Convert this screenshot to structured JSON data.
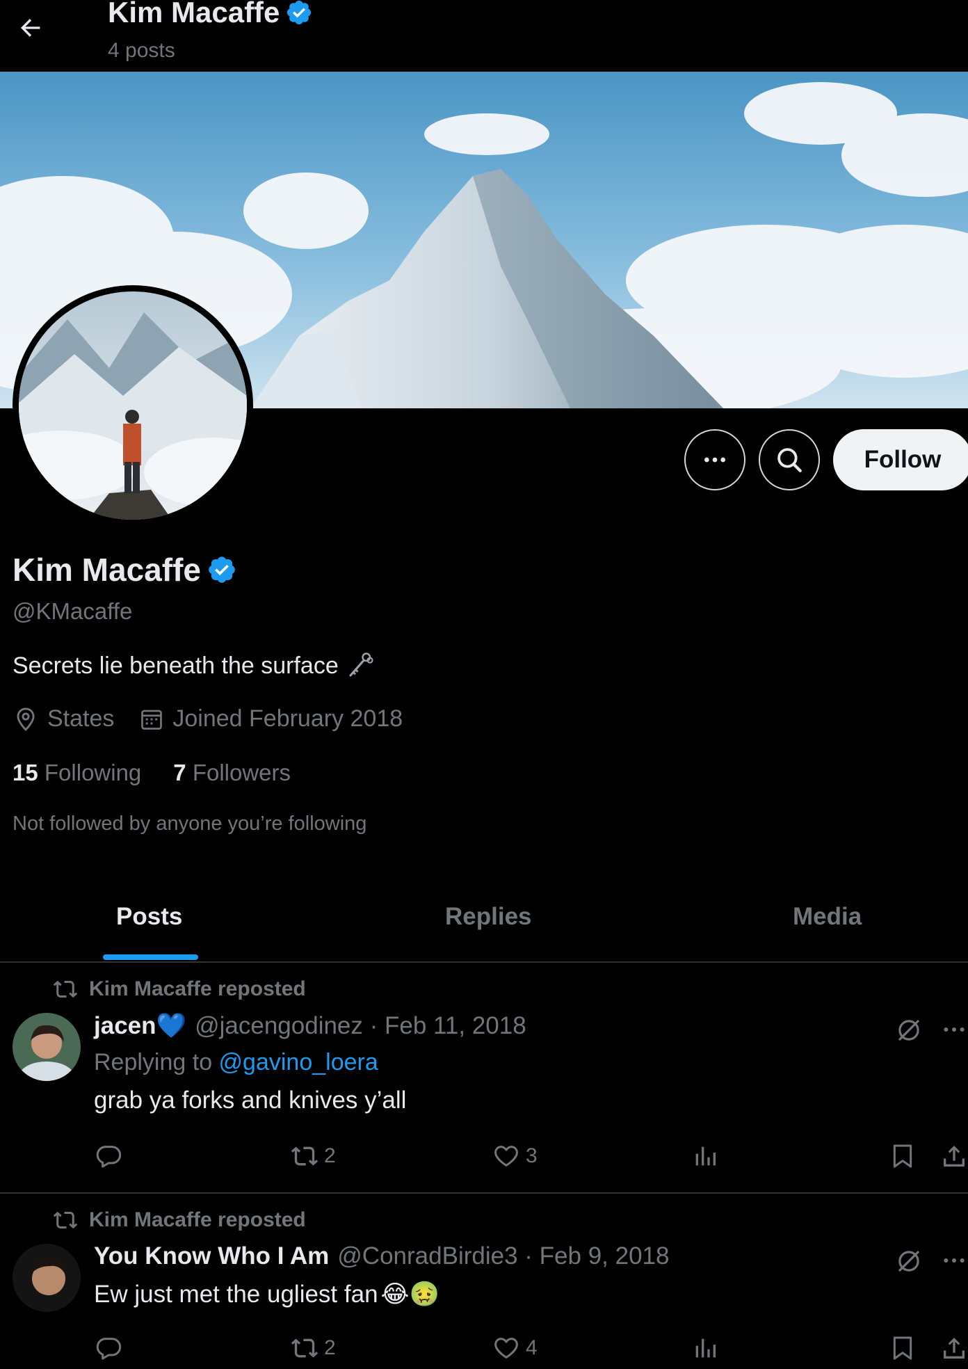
{
  "header": {
    "title": "Kim Macaffe",
    "post_count": "4 posts"
  },
  "profile": {
    "name": "Kim Macaffe",
    "handle": "@KMacaffe",
    "bio": "Secrets lie beneath the surface",
    "location": "States",
    "joined": "Joined February 2018",
    "following_count": "15",
    "following_label": "Following",
    "followers_count": "7",
    "followers_label": "Followers",
    "not_followed_note": "Not followed by anyone you’re following",
    "verified": true,
    "verified_color": "#1d9bf0"
  },
  "actions": {
    "more_icon": "more-icon",
    "search_icon": "search-icon",
    "follow_label": "Follow"
  },
  "tabs": [
    {
      "label": "Posts",
      "active": true
    },
    {
      "label": "Replies",
      "active": false
    },
    {
      "label": "Media",
      "active": false
    }
  ],
  "posts": [
    {
      "repost_label": "Kim Macaffe reposted",
      "author": "jacen",
      "author_suffix": "💙",
      "handle_date": "@jacengodinez · Feb 11, 2018",
      "replying_to_prefix": "Replying to ",
      "replying_to_handle": "@gavino_loera",
      "text": "grab ya forks and knives y’all",
      "reposts": "2",
      "likes": "3"
    },
    {
      "repost_label": "Kim Macaffe reposted",
      "author": "You Know Who I Am",
      "handle_date": "@ConradBirdie3 · Feb 9, 2018",
      "text": "Ew just met the ugliest fan",
      "text_emoji": "😂🤢",
      "reposts": "2",
      "likes": "4"
    }
  ],
  "colors": {
    "accent": "#1d9bf0",
    "background": "#000000",
    "muted_text": "#71767b"
  }
}
